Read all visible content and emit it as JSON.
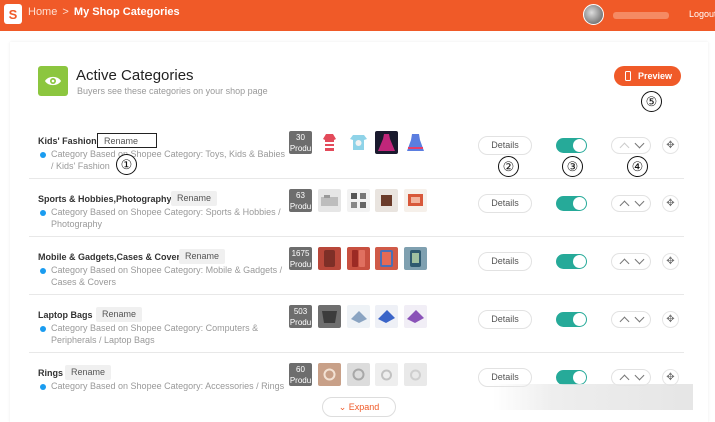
{
  "topbar": {
    "logo_letter": "S",
    "breadcrumb_home": "Home",
    "breadcrumb_sep": ">",
    "breadcrumb_current": "My Shop Categories",
    "logout_label": "Logout"
  },
  "header": {
    "title": "Active Categories",
    "subtitle": "Buyers see these categories on your shop page",
    "preview_label": "Preview"
  },
  "annotations": [
    "①",
    "②",
    "③",
    "④",
    "⑤"
  ],
  "row_labels": {
    "rename": "Rename",
    "details": "Details"
  },
  "categories": [
    {
      "name": "Kids' Fashion",
      "description": "Category Based on Shopee Category: Toys, Kids & Babies / Kids' Fashion",
      "product_count": "30",
      "count_suffix": "Produ",
      "enabled": true
    },
    {
      "name": "Sports & Hobbies,Photography",
      "description": "Category Based on Shopee Category: Sports & Hobbies / Photography",
      "product_count": "63",
      "count_suffix": "Produ",
      "enabled": true
    },
    {
      "name": "Mobile & Gadgets,Cases & Covers",
      "description": "Category Based on Shopee Category: Mobile & Gadgets / Cases & Covers",
      "product_count": "1675",
      "count_suffix": "Produ",
      "enabled": true
    },
    {
      "name": "Laptop Bags",
      "description": "Category Based on Shopee Category: Computers & Peripherals / Laptop Bags",
      "product_count": "503",
      "count_suffix": "Produ",
      "enabled": true
    },
    {
      "name": "Rings",
      "description": "Category Based on Shopee Category: Accessories / Rings",
      "product_count": "60",
      "count_suffix": "Produ",
      "enabled": true
    }
  ],
  "footer": {
    "expand_label": "Expand",
    "expand_icon": "chevron-down"
  },
  "colors": {
    "brand": "#f05a28",
    "toggle_on": "#26aa99",
    "eye_badge": "#8cc63f",
    "info_dot": "#1a9cf0"
  }
}
